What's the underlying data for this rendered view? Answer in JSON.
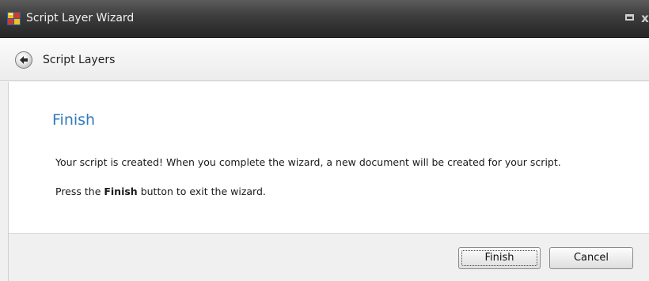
{
  "window": {
    "title": "Script Layer Wizard",
    "app_icon": "wizard-app-icon",
    "restore_icon": "restore-icon",
    "close_glyph": "x"
  },
  "header": {
    "back_icon": "back-arrow-icon",
    "title": "Script Layers"
  },
  "content": {
    "page_title": "Finish",
    "paragraph1": "Your script is created! When you complete the wizard, a new document will be created for your script.",
    "paragraph2_before": "Press the ",
    "paragraph2_bold": "Finish",
    "paragraph2_after": " button to exit the wizard."
  },
  "footer": {
    "finish_label": "Finish",
    "cancel_label": "Cancel"
  },
  "colors": {
    "title_bar": "#3c3c3c",
    "page_title": "#2f7bbd",
    "footer_bg": "#f0f0f0"
  }
}
